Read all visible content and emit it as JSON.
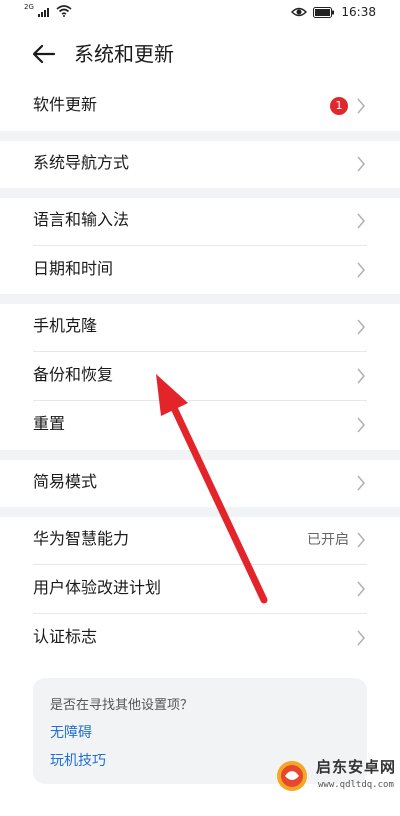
{
  "status_bar": {
    "network_label": "2G",
    "time": "16:38"
  },
  "header": {
    "title": "系统和更新"
  },
  "items": [
    {
      "label": "软件更新",
      "badge": "1"
    },
    {
      "label": "系统导航方式"
    },
    {
      "label": "语言和输入法"
    },
    {
      "label": "日期和时间"
    },
    {
      "label": "手机克隆"
    },
    {
      "label": "备份和恢复"
    },
    {
      "label": "重置"
    },
    {
      "label": "简易模式"
    },
    {
      "label": "华为智慧能力",
      "value": "已开启"
    },
    {
      "label": "用户体验改进计划"
    },
    {
      "label": "认证标志"
    }
  ],
  "help_card": {
    "title": "是否在寻找其他设置项？",
    "links": [
      "无障碍",
      "玩机技巧"
    ]
  },
  "annotation": {
    "arrow_color": "#e3242b"
  },
  "watermark": {
    "name": "启东安卓网",
    "url": "www.qdltdq.com"
  },
  "colors": {
    "accent": "#1f6fd6",
    "badge": "#e0292f",
    "separator": "#f1f3f5"
  }
}
